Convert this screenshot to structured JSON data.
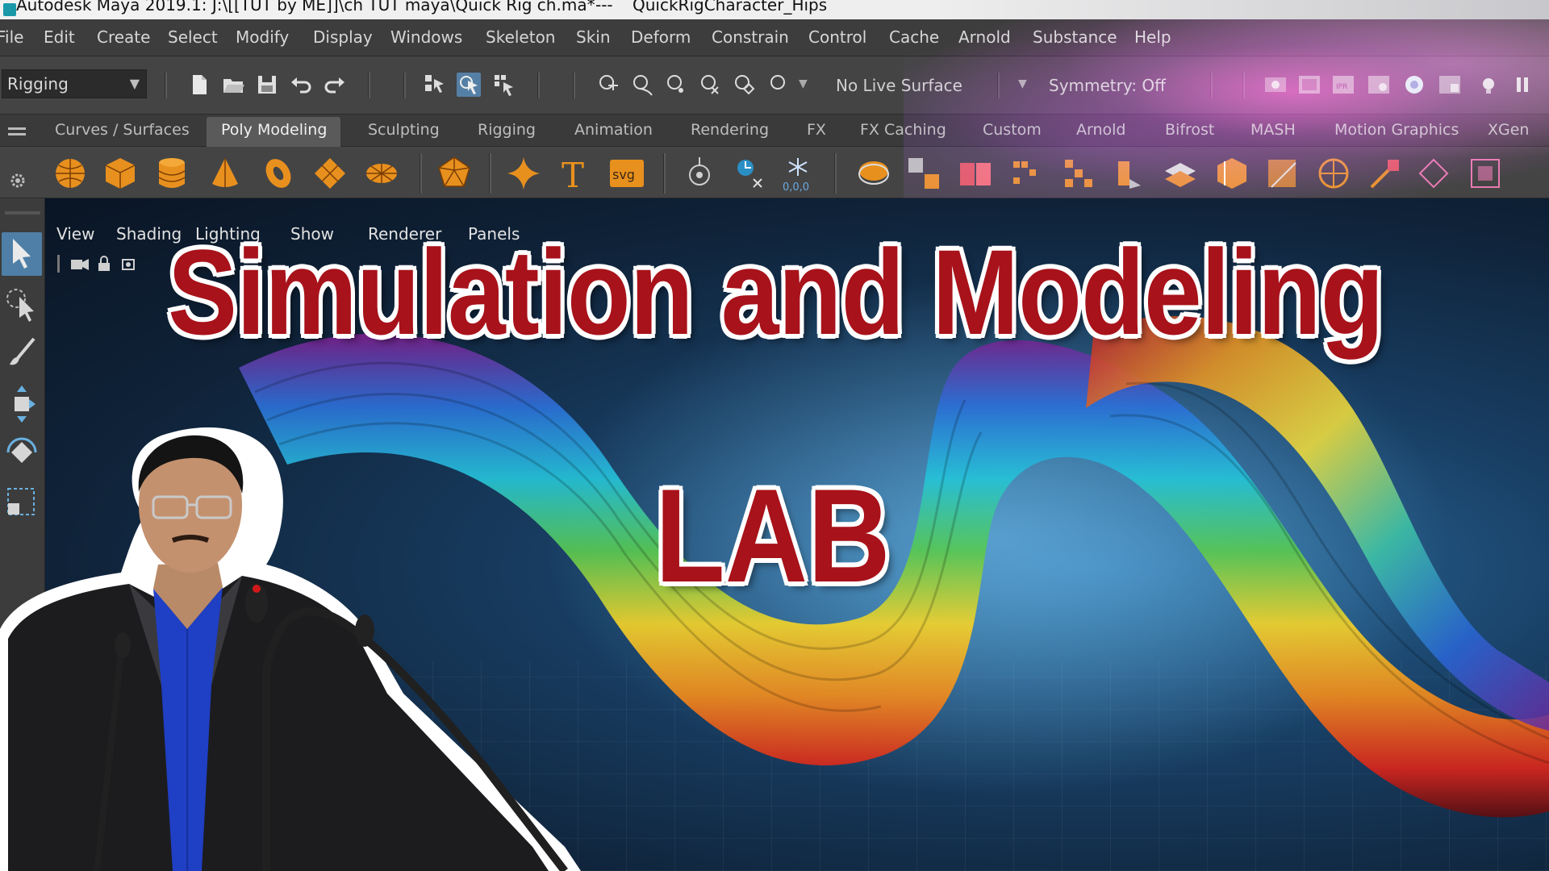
{
  "window": {
    "title": "Autodesk Maya 2019.1: J:\\[[TUT by ME]]\\ch TUT maya\\Quick Rig ch.ma*",
    "separator": "---",
    "scene_node": "QuickRigCharacter_Hips"
  },
  "menubar": {
    "items": [
      "File",
      "Edit",
      "Create",
      "Select",
      "Modify",
      "Display",
      "Windows",
      "Skeleton",
      "Skin",
      "Deform",
      "Constrain",
      "Control",
      "Cache",
      "Arnold",
      "Substance",
      "Help"
    ]
  },
  "statusline": {
    "mode": "Rigging",
    "live_surface": "No Live Surface",
    "symmetry": "Symmetry: Off"
  },
  "shelf": {
    "tabs": [
      "Curves / Surfaces",
      "Poly Modeling",
      "Sculpting",
      "Rigging",
      "Animation",
      "Rendering",
      "FX",
      "FX Caching",
      "Custom",
      "Arnold",
      "Bifrost",
      "MASH",
      "Motion Graphics",
      "XGen"
    ],
    "active_tab": "Poly Modeling",
    "text_icon_label": "T",
    "svg_icon_label": "svg",
    "snap_readout": "0,0,0"
  },
  "viewport": {
    "menus": [
      "View",
      "Shading",
      "Lighting",
      "Show",
      "Renderer",
      "Panels"
    ]
  },
  "headline": {
    "line1": "Simulation and Modeling",
    "line2": "LAB"
  },
  "colors": {
    "headline_red": "#a8121a",
    "headline_outline": "#ffffff",
    "maya_panel": "#444444",
    "maya_menubar": "#3d3d3d",
    "accent_blue": "#4f7fa6",
    "shelf_icon_orange": "#e8901e"
  }
}
